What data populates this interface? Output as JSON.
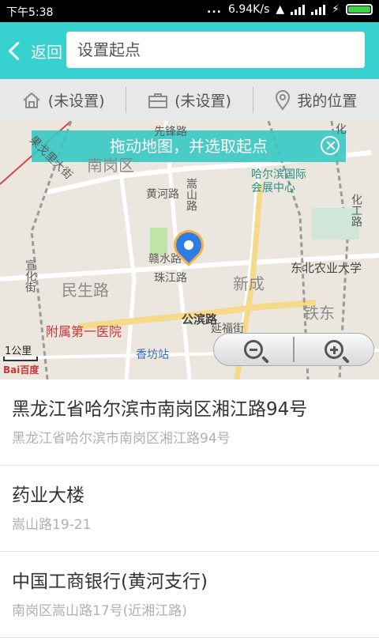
{
  "status_bar": {
    "time": "下午5:38",
    "dots": "...",
    "speed": "6.94K/s"
  },
  "topbar": {
    "back_label": "返回",
    "search_placeholder": "设置起点"
  },
  "presets": [
    {
      "label": "(未设置)",
      "icon": "home-icon"
    },
    {
      "label": "(未设置)",
      "icon": "briefcase-icon"
    },
    {
      "label": "我的位置",
      "icon": "location-pin-icon"
    }
  ],
  "map": {
    "tip": "拖动地图，并选取起点",
    "labels": {
      "nangang": "南岗区",
      "xianfeng": "先锋路",
      "heihe": "黄河路",
      "songshan": "嵩山路",
      "expo": "哈尔滨国际\n会展中心",
      "huagong": "化工路",
      "nongye": "东北农业大学",
      "ganshui": "赣水路",
      "zhujiang": "珠江路",
      "minsheng": "民生路",
      "xincheng": "新成",
      "tiedong": "铁东",
      "gongbin": "公滨路",
      "yanfu": "延福街",
      "hospital": "附属第一医院",
      "xiangfang": "香坊站",
      "xiangli": "果戈里大街",
      "xuan": "宣化街",
      "hua": "化"
    },
    "scale": "1公里",
    "logo": "Bai百度"
  },
  "results": [
    {
      "title": "黑龙江省哈尔滨市南岗区湘江路94号",
      "subtitle": "黑龙江省哈尔滨市南岗区湘江路94号"
    },
    {
      "title": "药业大楼",
      "subtitle": "嵩山路19-21"
    },
    {
      "title": "中国工商银行(黄河支行)",
      "subtitle": "南岗区嵩山路17号(近湘江路)"
    }
  ],
  "colors": {
    "accent": "#37d1cf",
    "pin": "#2d7ce4"
  }
}
